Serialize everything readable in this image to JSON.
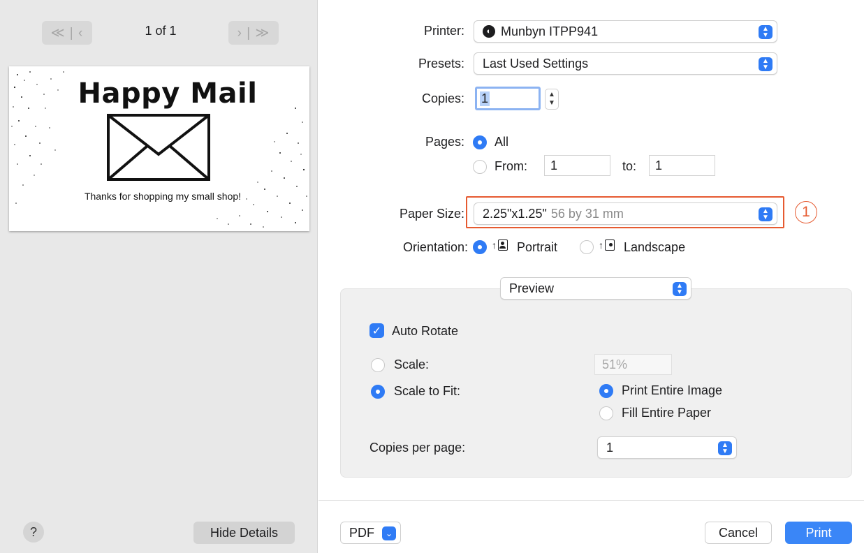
{
  "preview": {
    "first_prev_label": "≪ | ‹",
    "next_last_label": "› | ≫",
    "page_counter": "1 of 1",
    "thumb_title": "Happy Mail",
    "thumb_caption": "Thanks for shopping my small shop!"
  },
  "sidebar_footer": {
    "help_label": "?",
    "hide_details_label": "Hide Details"
  },
  "printer": {
    "label": "Printer:",
    "value": "Munbyn ITPP941"
  },
  "presets": {
    "label": "Presets:",
    "value": "Last Used Settings"
  },
  "copies": {
    "label": "Copies:",
    "value": "1"
  },
  "pages": {
    "label": "Pages:",
    "all_label": "All",
    "from_label": "From:",
    "from_value": "1",
    "to_label": "to:",
    "to_value": "1"
  },
  "paper_size": {
    "label": "Paper Size:",
    "value": "2.25\"x1.25\"",
    "detail": "56 by 31 mm",
    "callout": "1"
  },
  "orientation": {
    "label": "Orientation:",
    "portrait_label": "Portrait",
    "landscape_label": "Landscape"
  },
  "section": {
    "popup_value": "Preview",
    "auto_rotate_label": "Auto Rotate",
    "scale_label": "Scale:",
    "scale_value": "51%",
    "scale_to_fit_label": "Scale to Fit:",
    "print_entire_image_label": "Print Entire Image",
    "fill_entire_paper_label": "Fill Entire Paper",
    "copies_per_page_label": "Copies per page:",
    "copies_per_page_value": "1"
  },
  "footer": {
    "pdf_label": "PDF",
    "cancel_label": "Cancel",
    "print_label": "Print"
  },
  "colors": {
    "accent": "#2f7bf5",
    "highlight": "#e65a30"
  }
}
